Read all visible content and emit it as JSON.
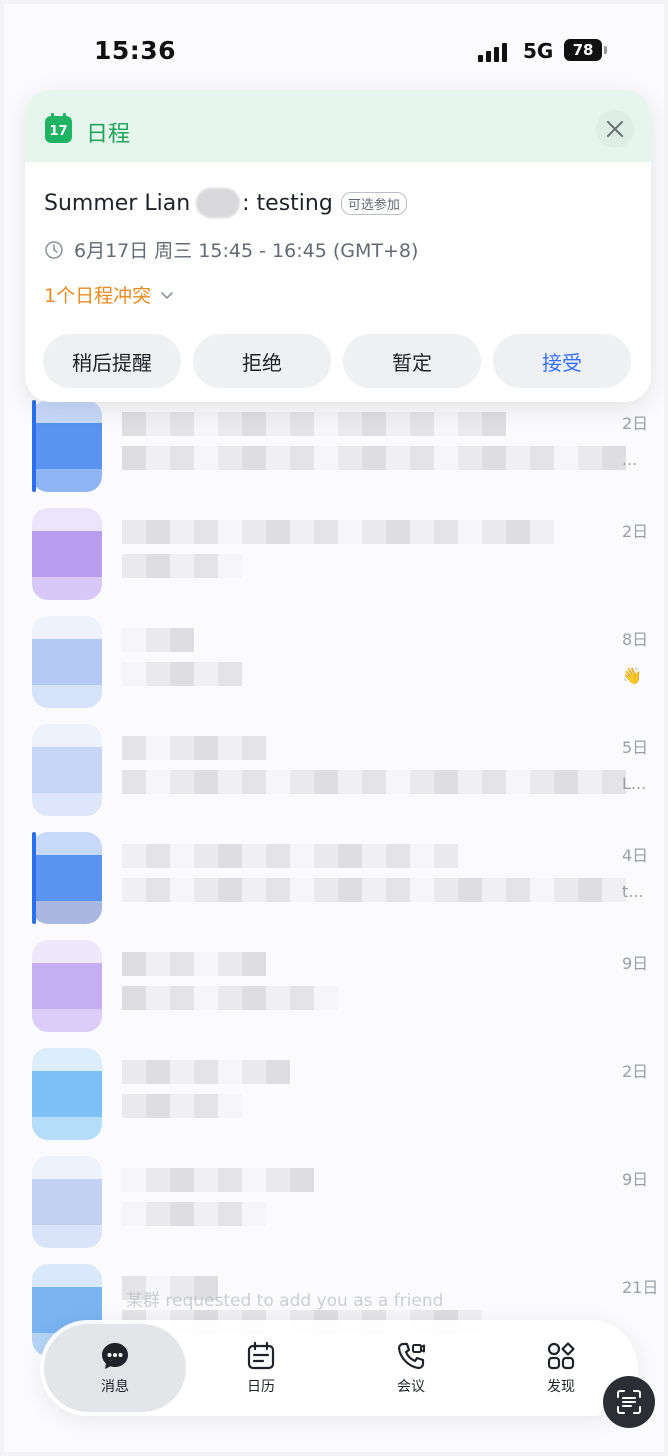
{
  "status_bar": {
    "time": "15:36",
    "network": "5G",
    "battery": "78"
  },
  "notification": {
    "app_icon_day": "17",
    "app_name": "日程",
    "title_prefix": "Summer Lian",
    "title_suffix": ": testing",
    "optional_tag": "可选参加",
    "time_text": "6月17日 周三 15:45 - 16:45 (GMT+8)",
    "conflict_text": "1个日程冲突",
    "actions": {
      "remind_later": "稍后提醒",
      "decline": "拒绝",
      "tentative": "暂定",
      "accept": "接受"
    },
    "colors": {
      "header_bg": "#e6f6ec",
      "brand_green": "#1fb463",
      "accept_blue": "#3370ff",
      "conflict_orange": "#e58b1f"
    }
  },
  "chat_list": {
    "rows": [
      {
        "date": "2日",
        "sub": "..."
      },
      {
        "date": "2日",
        "sub": ""
      },
      {
        "date": "8日",
        "sub": "👋"
      },
      {
        "date": "5日",
        "sub": "L..."
      },
      {
        "date": "4日",
        "sub": "t..."
      },
      {
        "date": "9日",
        "sub": ""
      },
      {
        "date": "2日",
        "sub": ""
      },
      {
        "date": "9日",
        "sub": ""
      },
      {
        "date": "21日",
        "sub": ""
      }
    ],
    "friend_request_text": "某群 requested to add you as a friend"
  },
  "tab_bar": {
    "tabs": {
      "messages": "消息",
      "calendar": "日历",
      "meetings": "会议",
      "discover": "发现"
    },
    "active": "messages"
  }
}
